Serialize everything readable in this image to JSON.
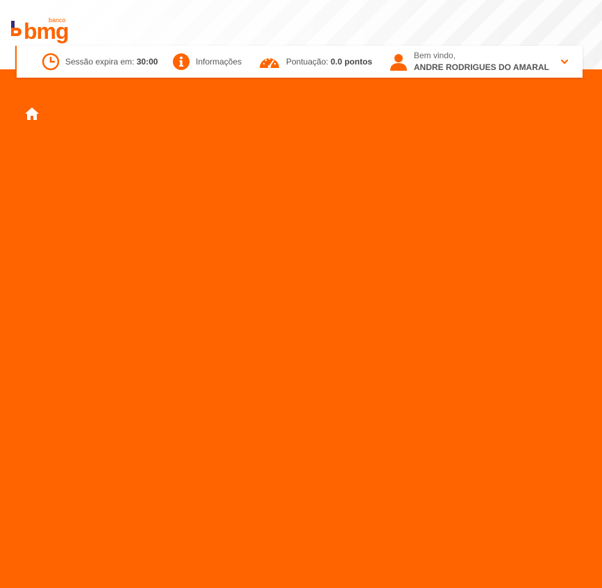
{
  "brand": {
    "small": "banco",
    "main": "bmg"
  },
  "topbar": {
    "session": {
      "label": "Sessão expira em:",
      "value": "30:00",
      "icon": "clock-icon"
    },
    "info": {
      "label": "Informações",
      "icon": "info-icon"
    },
    "score": {
      "label": "Pontuação:",
      "value": "0.0 pontos",
      "icon": "speedometer-icon"
    },
    "user": {
      "welcome": "Bem vindo,",
      "name": "ANDRE RODRIGUES DO AMARAL",
      "icon": "user-icon"
    },
    "dropdown_icon": "chevron-down-icon"
  },
  "nav": {
    "home_icon": "home-icon"
  },
  "colors": {
    "accent": "#ff6400",
    "background": "#ff6400",
    "text": "#555555"
  }
}
